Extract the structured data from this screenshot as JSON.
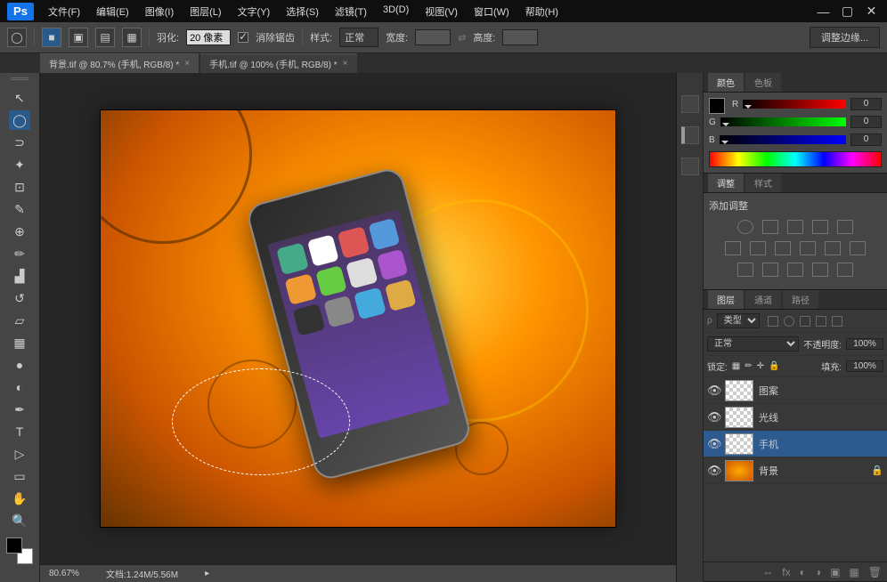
{
  "app": {
    "logo": "Ps"
  },
  "menu": {
    "file": "文件(F)",
    "edit": "编辑(E)",
    "image": "图像(I)",
    "layer": "图层(L)",
    "type": "文字(Y)",
    "select": "选择(S)",
    "filter": "滤镜(T)",
    "threed": "3D(D)",
    "view": "视图(V)",
    "window": "窗口(W)",
    "help": "帮助(H)"
  },
  "options": {
    "feather_label": "羽化:",
    "feather_value": "20 像素",
    "antialias_label": "消除锯齿",
    "style_label": "样式:",
    "style_value": "正常",
    "width_label": "宽度:",
    "height_label": "高度:",
    "refine_button": "调整边缘..."
  },
  "tabs": {
    "tab1": "背景.tif @ 80.7% (手机, RGB/8) *",
    "tab2": "手机.tif @ 100% (手机, RGB/8) *"
  },
  "status": {
    "zoom": "80.67%",
    "doc_label": "文档:",
    "doc_size": "1.24M/5.56M"
  },
  "panels": {
    "color_tab": "颜色",
    "swatches_tab": "色板",
    "r_label": "R",
    "g_label": "G",
    "b_label": "B",
    "r_val": "0",
    "g_val": "0",
    "b_val": "0",
    "adjust_tab": "调整",
    "styles_tab": "样式",
    "add_adjust": "添加调整",
    "layers_tab": "图层",
    "channels_tab": "通道",
    "paths_tab": "路径",
    "kind_label": "类型",
    "blend_mode": "正常",
    "opacity_label": "不透明度:",
    "opacity_val": "100%",
    "lock_label": "锁定:",
    "fill_label": "填充:",
    "fill_val": "100%"
  },
  "layers": [
    {
      "name": "图案",
      "thumb": "checker",
      "locked": false
    },
    {
      "name": "光线",
      "thumb": "checker",
      "locked": false
    },
    {
      "name": "手机",
      "thumb": "checker",
      "locked": false,
      "active": true
    },
    {
      "name": "背景",
      "thumb": "orange",
      "locked": true
    }
  ]
}
